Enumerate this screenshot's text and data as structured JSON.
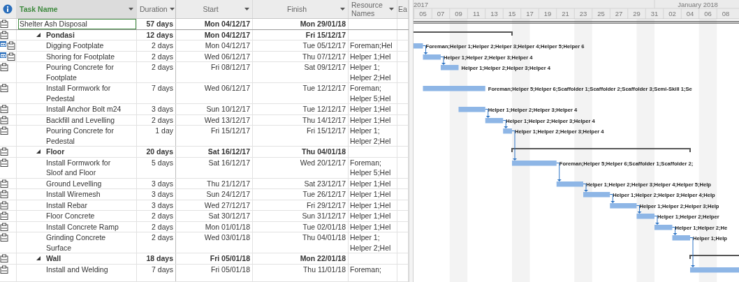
{
  "columns": [
    {
      "label": "Task Name",
      "selected": true
    },
    {
      "label": "Duration",
      "selected": false
    },
    {
      "label": "Start",
      "selected": false
    },
    {
      "label": "Finish",
      "selected": false
    },
    {
      "label": "Resource\nNames",
      "selected": false
    },
    {
      "label": "Ea",
      "selected": false
    }
  ],
  "timescale": {
    "upper": [
      "2017",
      "January 2018"
    ],
    "lower": [
      "05",
      "07",
      "09",
      "11",
      "13",
      "15",
      "17",
      "19",
      "21",
      "23",
      "25",
      "27",
      "29",
      "31",
      "02",
      "04",
      "06",
      "08"
    ]
  },
  "tasks": [
    {
      "kind": "project",
      "name": "Shelter Ash Disposal",
      "duration": "57 days",
      "start": "Mon 04/12/17",
      "finish": "Mon 29/01/18",
      "selected": true,
      "children": [
        {
          "kind": "summary",
          "name": "Pondasi",
          "duration": "12 days",
          "start": "Mon 04/12/17",
          "finish": "Fri 15/12/17",
          "selected": false,
          "expanded": true,
          "children": [
            {
              "kind": "task",
              "name": "Digging Footplate",
              "duration": "2 days",
              "start": "Mon 04/12/17",
              "finish": "Tue 05/12/17",
              "resources": "Foreman;Hel",
              "gantt_label": "Foreman;Helper 1;Helper 2;Helper 3;Helper 4;Helper 5;Helper 6",
              "selected": false,
              "extra_indicator": true
            },
            {
              "kind": "task",
              "name": "Shoring for Footplate",
              "duration": "2 days",
              "start": "Wed 06/12/17",
              "finish": "Thu 07/12/17",
              "resources": "Helper 1;Hel",
              "gantt_label": "Helper 1;Helper 2;Helper 3;Helper 4",
              "selected": false,
              "extra_indicator": true
            },
            {
              "kind": "task",
              "name": "Pouring Concrete for\nFootplate",
              "duration": "2 days",
              "start": "Fri 08/12/17",
              "finish": "Sat 09/12/17",
              "resources": "Helper 1;\nHelper 2;Hel",
              "gantt_label": "Helper 1;Helper 2;Helper 3;Helper 4",
              "selected": false,
              "extra_indicator": false
            },
            {
              "kind": "task",
              "name": "Install Formwork for\nPedestal",
              "duration": "7 days",
              "start": "Wed 06/12/17",
              "finish": "Tue 12/12/17",
              "resources": "Foreman;\nHelper 5;Hel",
              "gantt_label": "Foreman;Helper 5;Helper 6;Scaffolder 1;Scaffolder 2;Scaffolder 3;Semi-Skill 1;Se",
              "selected": false,
              "extra_indicator": false
            },
            {
              "kind": "task",
              "name": "Install Anchor Bolt m24",
              "duration": "3 days",
              "start": "Sun 10/12/17",
              "finish": "Tue 12/12/17",
              "resources": "Helper 1;Hel",
              "gantt_label": "Helper 1;Helper 2;Helper 3;Helper 4",
              "selected": false,
              "extra_indicator": false
            },
            {
              "kind": "task",
              "name": "Backfill and Levelling",
              "duration": "2 days",
              "start": "Wed 13/12/17",
              "finish": "Thu 14/12/17",
              "resources": "Helper 1;Hel",
              "gantt_label": "Helper 1;Helper 2;Helper 3;Helper 4",
              "selected": false,
              "extra_indicator": false
            },
            {
              "kind": "task",
              "name": "Pouring Concrete for\nPedestal",
              "duration": "1 day",
              "start": "Fri 15/12/17",
              "finish": "Fri 15/12/17",
              "resources": "Helper 1;\nHelper 2;Hel",
              "gantt_label": "Helper 1;Helper 2;Helper 3;Helper 4",
              "selected": false,
              "extra_indicator": false
            }
          ]
        },
        {
          "kind": "summary",
          "name": "Floor",
          "duration": "20 days",
          "start": "Sat 16/12/17",
          "finish": "Thu 04/01/18",
          "selected": false,
          "expanded": true,
          "children": [
            {
              "kind": "task",
              "name": "Install Formwork for\nSloof and Floor",
              "duration": "5 days",
              "start": "Sat 16/12/17",
              "finish": "Wed 20/12/17",
              "resources": "Foreman;\nHelper 5;Hel",
              "gantt_label": "Foreman;Helper 5;Helper 6;Scaffolder 1;Scaffolder 2;",
              "selected": false,
              "extra_indicator": false
            },
            {
              "kind": "task",
              "name": "Ground Levelling",
              "duration": "3 days",
              "start": "Thu 21/12/17",
              "finish": "Sat 23/12/17",
              "resources": "Helper 1;Hel",
              "gantt_label": "Helper 1;Helper 2;Helper 3;Helper 4;Helper 5;Help",
              "selected": false,
              "extra_indicator": false
            },
            {
              "kind": "task",
              "name": "Install Wiremesh",
              "duration": "3 days",
              "start": "Sun 24/12/17",
              "finish": "Tue 26/12/17",
              "resources": "Helper 1;Hel",
              "gantt_label": "Helper 1;Helper 2;Helper 3;Helper 4;Help",
              "selected": false,
              "extra_indicator": false
            },
            {
              "kind": "task",
              "name": "Install Rebar",
              "duration": "3 days",
              "start": "Wed 27/12/17",
              "finish": "Fri 29/12/17",
              "resources": "Helper 1;Hel",
              "gantt_label": "Helper 1;Helper 2;Helper 3;Help",
              "selected": false,
              "extra_indicator": false
            },
            {
              "kind": "task",
              "name": "Floor Concrete",
              "duration": "2 days",
              "start": "Sat 30/12/17",
              "finish": "Sun 31/12/17",
              "resources": "Helper 1;Hel",
              "gantt_label": "Helper 1;Helper 2;Helper",
              "selected": false,
              "extra_indicator": false
            },
            {
              "kind": "task",
              "name": "Install Concrete Ramp",
              "duration": "2 days",
              "start": "Mon 01/01/18",
              "finish": "Tue 02/01/18",
              "resources": "Helper 1;Hel",
              "gantt_label": "Helper 1;Helper 2;He",
              "selected": false,
              "extra_indicator": false
            },
            {
              "kind": "task",
              "name": "Grinding Concrete\nSurface",
              "duration": "2 days",
              "start": "Wed 03/01/18",
              "finish": "Thu 04/01/18",
              "resources": "Helper 1;\nHelper 2;Hel",
              "gantt_label": "Helper 1;Help",
              "selected": false,
              "extra_indicator": false
            }
          ]
        },
        {
          "kind": "summary",
          "name": "Wall",
          "duration": "18 days",
          "start": "Fri 05/01/18",
          "finish": "Mon 22/01/18",
          "selected": false,
          "expanded": true,
          "children": [
            {
              "kind": "task",
              "name": "Install and Welding",
              "duration": "7 days",
              "start": "Fri 05/01/18",
              "finish": "Thu 11/01/18",
              "resources": "Foreman;",
              "selected": false,
              "extra_indicator": false
            }
          ]
        }
      ]
    }
  ]
}
